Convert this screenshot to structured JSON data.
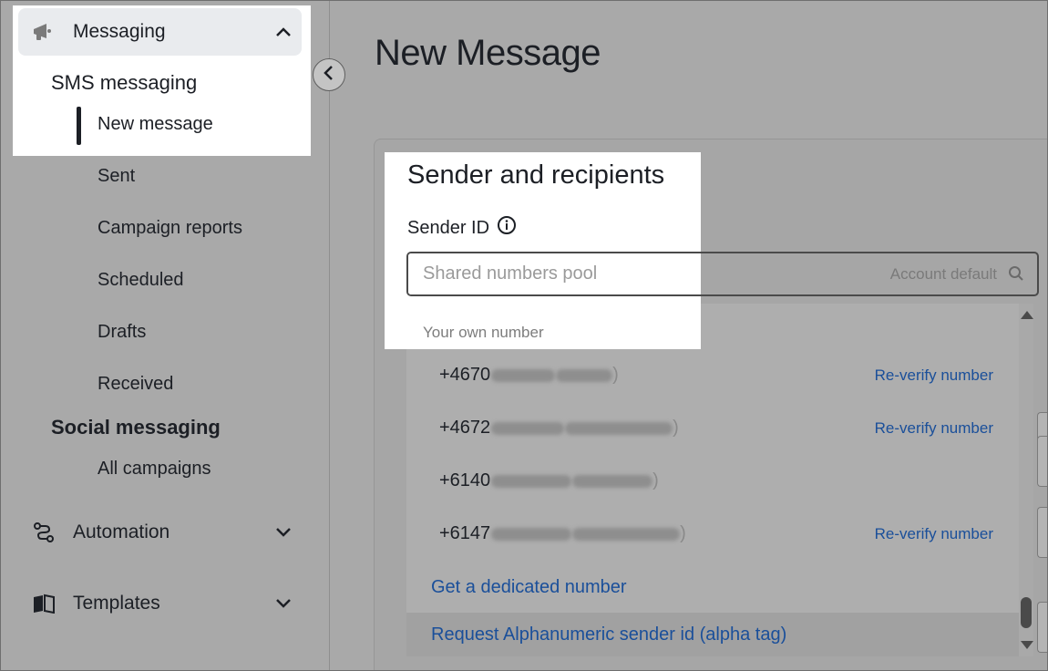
{
  "sidebar": {
    "messaging": {
      "label": "Messaging",
      "icon": "megaphone-icon"
    },
    "sms_messaging": "SMS messaging",
    "sms_items": [
      "New message",
      "Sent",
      "Campaign reports",
      "Scheduled",
      "Drafts",
      "Received"
    ],
    "social_messaging": "Social messaging",
    "social_items": [
      "All campaigns"
    ],
    "automation": {
      "label": "Automation",
      "icon": "flow-icon"
    },
    "templates": {
      "label": "Templates",
      "icon": "book-icon"
    }
  },
  "main": {
    "page_title": "New Message",
    "card_title": "Sender and recipients",
    "sender_label": "Sender ID",
    "search": {
      "placeholder": "Shared numbers pool",
      "default_label": "Account default"
    },
    "dropdown": {
      "group_label": "Your own number",
      "numbers": [
        {
          "prefix": "+4670",
          "close_paren": ")",
          "action": "Re-verify number"
        },
        {
          "prefix": "+4672",
          "close_paren": ")",
          "action": "Re-verify number"
        },
        {
          "prefix": "+6140",
          "close_paren": ")",
          "action": ""
        },
        {
          "prefix": "+6147",
          "close_paren": ")",
          "action": "Re-verify number"
        }
      ],
      "dedicated_link": "Get a dedicated number",
      "alpha_link": "Request Alphanumeric sender id (alpha tag)"
    }
  },
  "colors": {
    "link": "#1a4f9a",
    "text": "#1c1f25",
    "overlay": "#a9a9a9"
  }
}
